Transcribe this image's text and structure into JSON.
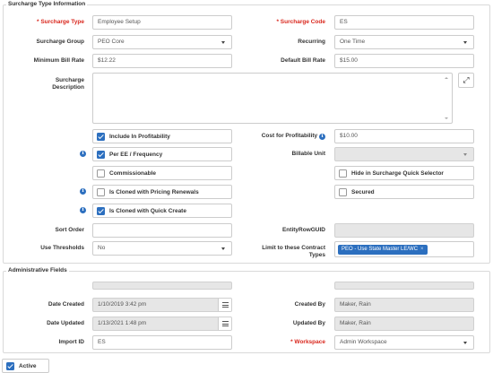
{
  "sections": {
    "surcharge_info": "Surcharge Type Information",
    "admin": "Administrative Fields"
  },
  "labels": {
    "surcharge_type": "Surcharge Type",
    "surcharge_code": "Surcharge Code",
    "surcharge_group": "Surcharge Group",
    "recurring": "Recurring",
    "minimum_bill_rate": "Minimum Bill Rate",
    "default_bill_rate": "Default Bill Rate",
    "surcharge_description_1": "Surcharge",
    "surcharge_description_2": "Description",
    "cost_for_profitability": "Cost for Profitability",
    "billable_unit": "Billable Unit",
    "sort_order": "Sort Order",
    "entity_row_guid": "EntityRowGUID",
    "use_thresholds": "Use Thresholds",
    "limit_contract_types_1": "Limit to these Contract",
    "limit_contract_types_2": "Types",
    "date_created": "Date Created",
    "created_by": "Created By",
    "date_updated": "Date Updated",
    "updated_by": "Updated By",
    "import_id": "Import ID",
    "workspace": "Workspace",
    "required_marker": "*"
  },
  "values": {
    "surcharge_type": "Employee Setup",
    "surcharge_code": "ES",
    "surcharge_group": "PEO Core",
    "recurring": "One Time",
    "minimum_bill_rate": "$12.22",
    "default_bill_rate": "$15.00",
    "surcharge_description": "",
    "cost_for_profitability": "$10.00",
    "billable_unit": "",
    "sort_order": "",
    "entity_row_guid": "",
    "use_thresholds": "No",
    "contract_type_tag": "PEO - Use State Master LE/WC",
    "tag_remove": "×",
    "date_created": "1/10/2019 3:42 pm",
    "created_by": "Maker, Rain",
    "date_updated": "1/13/2021 1:48 pm",
    "updated_by": "Maker, Rain",
    "import_id": "ES",
    "workspace": "Admin Workspace"
  },
  "checkboxes": {
    "include_in_profitability": {
      "label": "Include In Profitability",
      "checked": true
    },
    "per_ee_frequency": {
      "label": "Per EE / Frequency",
      "checked": true
    },
    "commissionable": {
      "label": "Commissionable",
      "checked": false
    },
    "hide_in_quick_selector": {
      "label": "Hide in Surcharge Quick Selector",
      "checked": false
    },
    "cloned_with_pricing_renewals": {
      "label": "Is Cloned with Pricing Renewals",
      "checked": false
    },
    "secured": {
      "label": "Secured",
      "checked": false
    },
    "cloned_with_quick_create": {
      "label": "Is Cloned with Quick Create",
      "checked": true
    },
    "active": {
      "label": "Active",
      "checked": true
    }
  },
  "icons": {
    "info": "i",
    "expand": "⤢"
  },
  "colors": {
    "accent": "#2c6fbf",
    "required": "#d9261c",
    "disabled_bg": "#e6e6e6"
  }
}
